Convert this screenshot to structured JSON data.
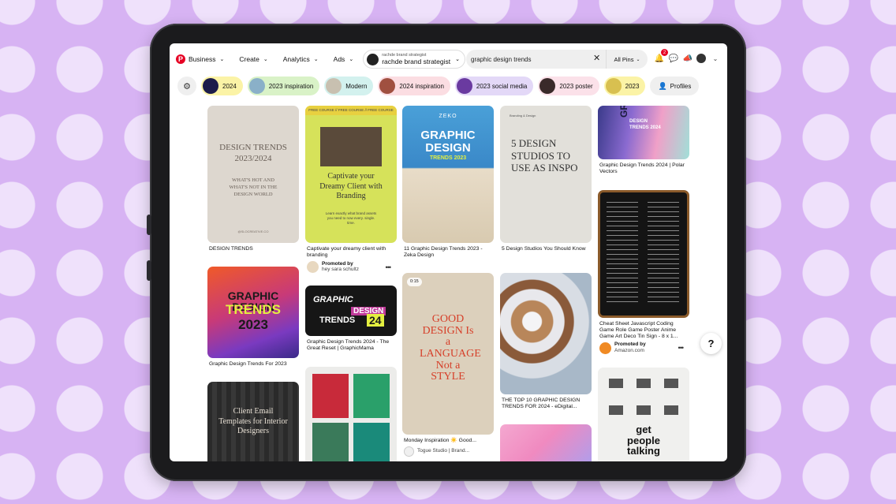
{
  "nav": {
    "business": "Business",
    "create": "Create",
    "analytics": "Analytics",
    "ads": "Ads",
    "account_small": "rachde brand strategist",
    "account_name": "rachde brand strategist"
  },
  "search": {
    "value": "graphic design trends",
    "scope": "All Pins"
  },
  "notifications": {
    "count": "2"
  },
  "chips": [
    {
      "label": "2024",
      "bg": "#fbf3a6"
    },
    {
      "label": "2023 inspiration",
      "bg": "#d9f2c7"
    },
    {
      "label": "Modern",
      "bg": "#d3f1ee"
    },
    {
      "label": "2024 inspiration",
      "bg": "#fbdde2"
    },
    {
      "label": "2023 social media",
      "bg": "#e3d8f7"
    },
    {
      "label": "2023 poster",
      "bg": "#fbe1e9"
    },
    {
      "label": "2023",
      "bg": "#fbf3a6"
    }
  ],
  "profiles_label": "Profiles",
  "pins": {
    "p1": {
      "title": "DESIGN TRENDS",
      "img_title": "DESIGN TRENDS 2023/2024",
      "img_sub": "WHAT'S HOT AND WHAT'S NOT IN THE DESIGN WORLD",
      "img_foot": "@SLOCREATIVE.CO"
    },
    "p2": {
      "title": "Graphic Design Trends For 2023",
      "img_line1": "GRAPHIC DESIGN",
      "img_line2": "TRENDS",
      "img_line3": "2023"
    },
    "p3": {
      "img_text": "Client Email Templates for Interior Designers"
    },
    "p4": {
      "title": "Captivate your dreamy client with branding",
      "img_text": "Captivate your Dreamy Client with Branding",
      "img_sub": "Learn exactly what brand assets you need to now every. single. time.",
      "ribbon": "FREE COURSE // FREE COURSE // FREE COURSE",
      "promoted": "Promoted by",
      "advertiser": "hey sara schultz"
    },
    "p5": {
      "title": "Graphic Design Trends 2024 - The Great Reset | GraphicMama",
      "img_l1": "GRAPHIC",
      "img_l2": "DESIGN",
      "img_l3": "TRENDS",
      "img_l4": "24"
    },
    "p7": {
      "title": "11 Graphic Design Trends 2023 - Zeka Design",
      "brand": "ZEKO",
      "img_l1": "GRAPHIC",
      "img_l2": "DESIGN",
      "img_l3": "TRENDS 2023"
    },
    "p8": {
      "title": "Monday Inspiration ☀️ Good...",
      "duration": "0:15",
      "img_text": "GOOD DESIGN Is a LANGUAGE Not a STYLE",
      "credit": "Togue Studio | Brand..."
    },
    "p9": {
      "title": "5 Design Studios You Should Know",
      "img_text": "5 DESIGN STUDIOS TO USE AS INSPO",
      "img_small": "Branding & Design"
    },
    "p10": {
      "title": "THE TOP 10 GRAPHIC DESIGN TRENDS FOR 2024 - eDigital..."
    },
    "p12": {
      "title": "Graphic Design Trends 2024 | Polar Vectors",
      "img_l1": "GRAPHIC",
      "img_l2": "DESIGN TRENDS 2024"
    },
    "p13": {
      "title": "Cheat Sheet Javascript Coding Game Role Game Poster Anime Game Art Deco Tin Sign - 8 x 1...",
      "promoted": "Promoted by",
      "advertiser": "Amazon.com"
    },
    "p14": {
      "img_text": "get people talking"
    }
  },
  "help_label": "?",
  "colors": {
    "brand": "#e60023",
    "background": "#d7b3f3",
    "polka": "#efe1fb"
  }
}
